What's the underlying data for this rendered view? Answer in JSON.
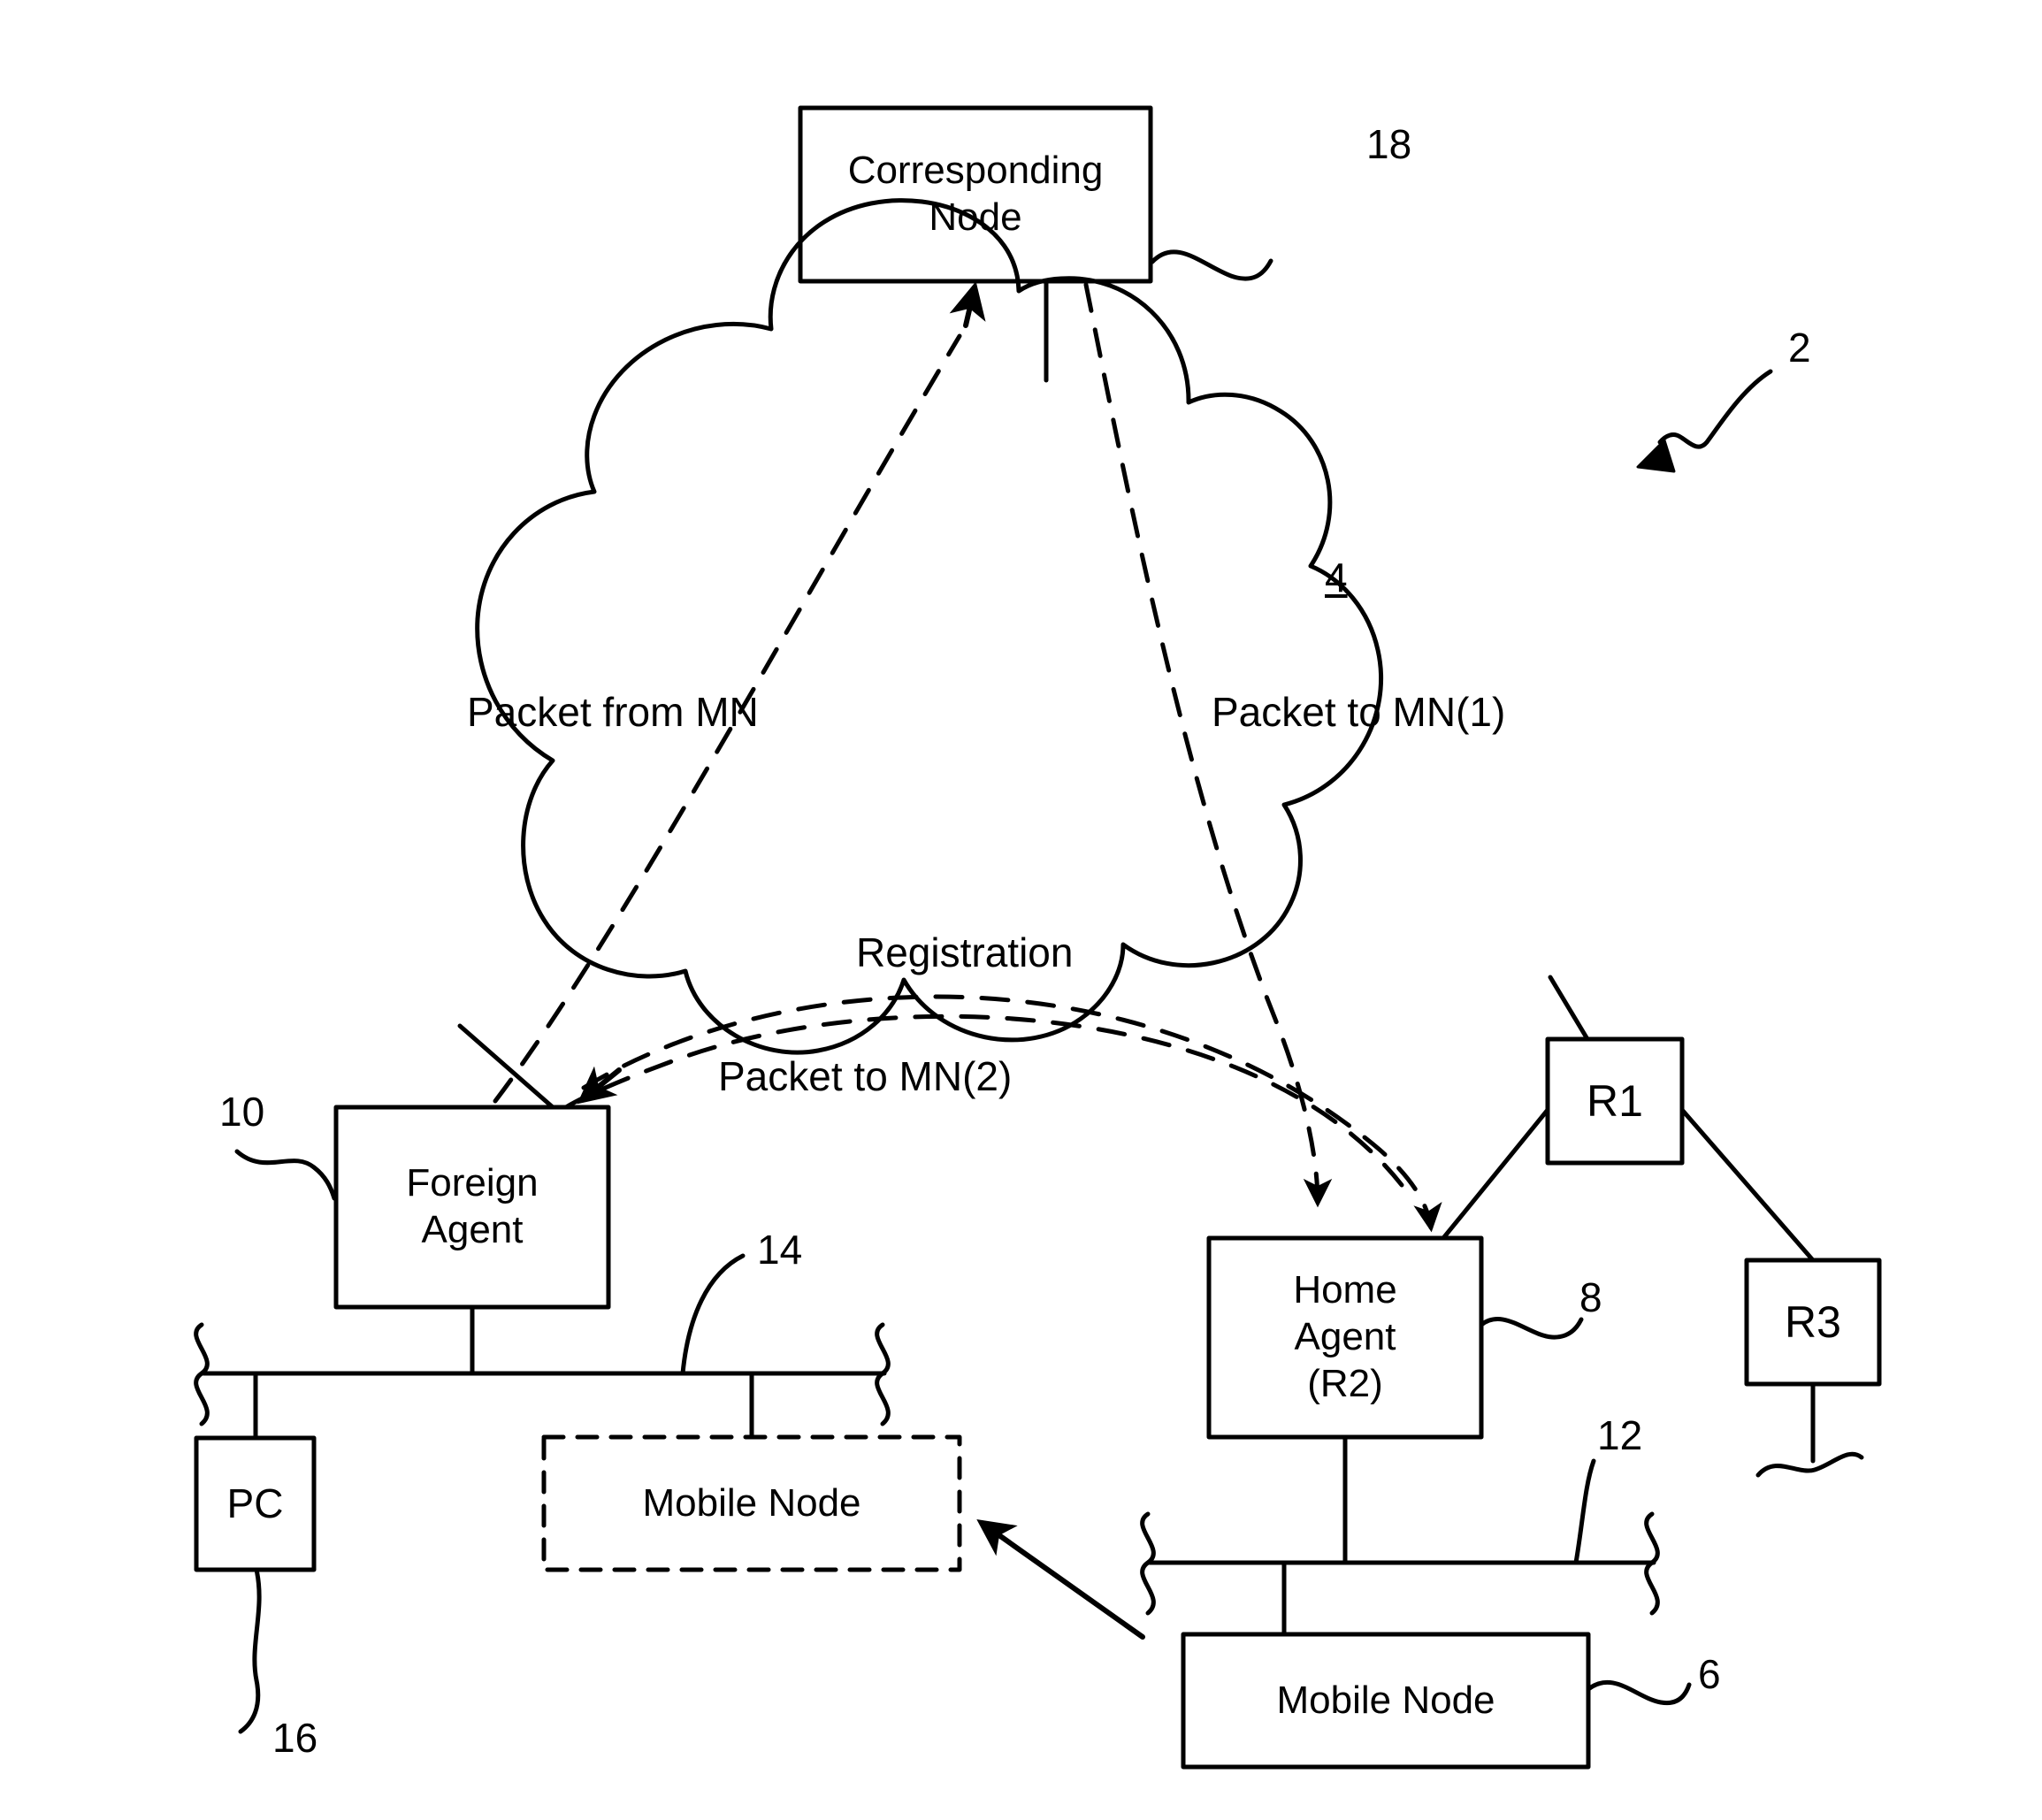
{
  "figure": {
    "type": "patent-network-diagram",
    "title_ref": "2"
  },
  "nodes": {
    "corresponding_node": {
      "label_line1": "Corresponding",
      "label_line2": "Node",
      "ref": "18"
    },
    "cloud": {
      "ref": "4"
    },
    "foreign_agent": {
      "label_line1": "Foreign",
      "label_line2": "Agent",
      "ref": "10"
    },
    "home_agent": {
      "label_line1": "Home",
      "label_line2": "Agent",
      "label_line3": "(R2)",
      "ref": "8"
    },
    "router_r1": {
      "label": "R1"
    },
    "router_r3": {
      "label": "R3"
    },
    "pc": {
      "label": "PC",
      "ref": "16"
    },
    "mobile_node_dashed": {
      "label": "Mobile Node"
    },
    "mobile_node_solid": {
      "label": "Mobile Node",
      "ref": "6"
    },
    "foreign_network_bus": {
      "ref": "14"
    },
    "home_network_bus": {
      "ref": "12"
    }
  },
  "flows": {
    "packet_from_mn": "Packet from MN",
    "packet_to_mn_1": "Packet to MN(1)",
    "registration": "Registration",
    "packet_to_mn_2": "Packet to MN(2)"
  },
  "refs": {
    "diagram": "2",
    "mobile_node_solid": "6",
    "home_agent": "8",
    "foreign_agent": "10",
    "home_bus": "12",
    "foreign_bus": "14",
    "pc": "16",
    "corresponding_node": "18",
    "cloud": "4"
  },
  "colors": {
    "stroke": "#000000",
    "background": "#ffffff"
  }
}
